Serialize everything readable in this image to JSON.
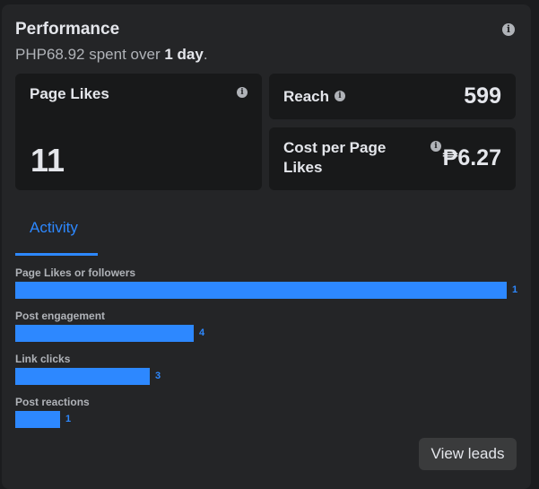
{
  "header": {
    "title": "Performance",
    "spent_amount": "PHP68.92",
    "spent_middle": " spent over ",
    "spent_period": "1 day",
    "spent_end": "."
  },
  "metrics": {
    "page_likes": {
      "label": "Page Likes",
      "value": "11"
    },
    "reach": {
      "label": "Reach",
      "value": "599"
    },
    "cost_per_page_like": {
      "label_line1": "Cost per Page",
      "label_line2": "Likes",
      "value": "₱6.27"
    }
  },
  "tabs": {
    "activity": "Activity"
  },
  "activity_bars": [
    {
      "label": "Page Likes or followers",
      "count": "1",
      "fill": 1.0
    },
    {
      "label": "Post engagement",
      "count": "4",
      "fill": 0.364
    },
    {
      "label": "Link clicks",
      "count": "3",
      "fill": 0.273
    },
    {
      "label": "Post reactions",
      "count": "1",
      "fill": 0.091
    }
  ],
  "buttons": {
    "view_leads": "View leads"
  },
  "icons": {
    "info": "info-icon"
  },
  "colors": {
    "accent": "#2d88ff",
    "panel": "#242527",
    "card": "#18191a",
    "text": "#e4e6eb",
    "muted": "#b0b3b8"
  }
}
